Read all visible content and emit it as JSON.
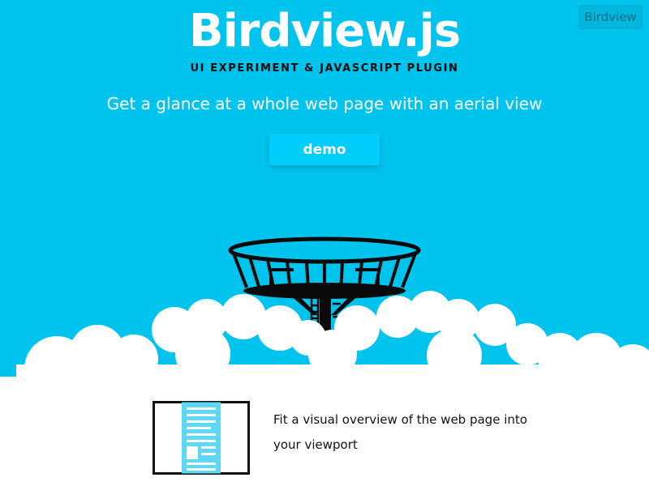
{
  "header": {
    "title": "Birdview.js",
    "subtitle": "UI EXPERIMENT & JAVASCRIPT PLUGIN",
    "tagline": "Get a glance at a whole web page with an aerial view",
    "demo_label": "demo",
    "corner_button_label": "Birdview"
  },
  "colors": {
    "hero_background": "#00c4ee",
    "button": "#00cdf9",
    "tower": "#0a0a0a",
    "cloud": "#ffffff"
  },
  "feature": {
    "icon": "viewport-overview-icon",
    "text": "Fit a visual overview of the web page into your viewport"
  }
}
